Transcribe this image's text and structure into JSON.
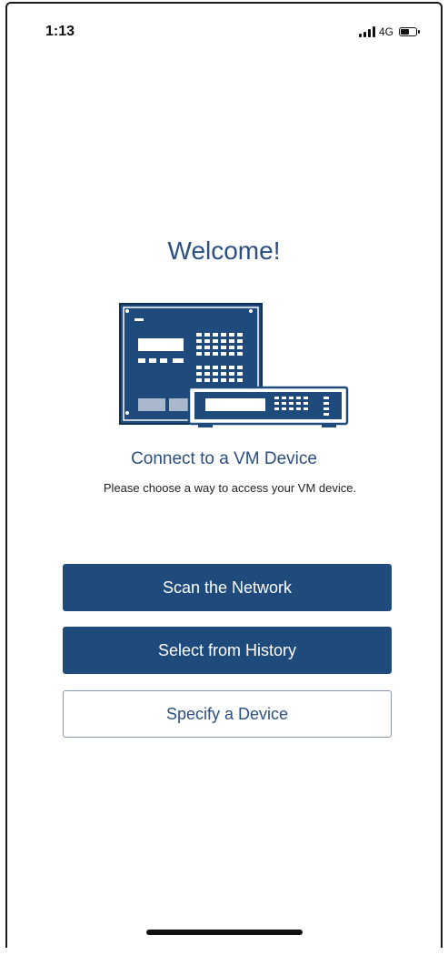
{
  "status_bar": {
    "time": "1:13",
    "network": "4G",
    "battery_level": 0.6
  },
  "main": {
    "title": "Welcome!",
    "subtitle": "Connect to a VM Device",
    "description": "Please choose a way to access your VM device."
  },
  "actions": {
    "scan_label": "Scan the Network",
    "history_label": "Select from History",
    "specify_label": "Specify a Device"
  },
  "colors": {
    "brand": "#1f4a7c",
    "heading": "#2c4f80",
    "outline": "#8a97a8"
  },
  "icons": {
    "illustration": "vm-device-illustration",
    "signal": "signal-bars-icon",
    "battery": "battery-icon"
  }
}
